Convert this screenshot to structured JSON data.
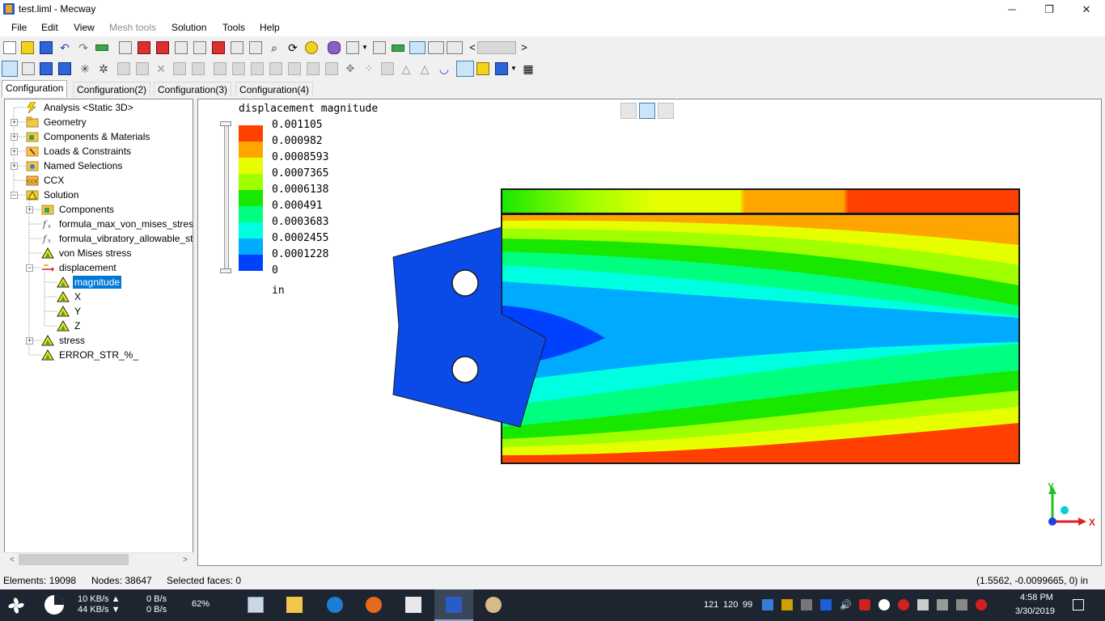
{
  "window": {
    "title": "test.liml - Mecway",
    "minimize": "─",
    "restore": "❐",
    "close": "✕"
  },
  "menu": [
    {
      "label": "File",
      "enabled": true
    },
    {
      "label": "Edit",
      "enabled": true
    },
    {
      "label": "View",
      "enabled": true
    },
    {
      "label": "Mesh tools",
      "enabled": false
    },
    {
      "label": "Solution",
      "enabled": true
    },
    {
      "label": "Tools",
      "enabled": true
    },
    {
      "label": "Help",
      "enabled": true
    }
  ],
  "toolbar": {
    "scroll_left": "<",
    "scroll_right": ">"
  },
  "tabs": [
    "Configuration",
    "Configuration(2)",
    "Configuration(3)",
    "Configuration(4)"
  ],
  "tree": [
    {
      "label": "Analysis <Static 3D>",
      "icon": "lightning-icon"
    },
    {
      "label": "Geometry",
      "icon": "folder-icon"
    },
    {
      "label": "Components & Materials",
      "icon": "components-icon"
    },
    {
      "label": "Loads & Constraints",
      "icon": "loads-icon"
    },
    {
      "label": "Named Selections",
      "icon": "named-selections-icon"
    },
    {
      "label": "CCX",
      "icon": "ccx-icon"
    },
    {
      "label": "Solution",
      "icon": "solution-icon"
    },
    {
      "label": "Components",
      "icon": "components-icon"
    },
    {
      "label": "formula_max_von_mises_stress_",
      "icon": "formula-icon"
    },
    {
      "label": "formula_vibratory_allowable_stre",
      "icon": "formula-icon"
    },
    {
      "label": "von Mises stress",
      "icon": "contour-icon"
    },
    {
      "label": "displacement",
      "icon": "displacement-icon"
    },
    {
      "label": "magnitude",
      "icon": "contour-icon"
    },
    {
      "label": "X",
      "icon": "contour-icon"
    },
    {
      "label": "Y",
      "icon": "contour-icon"
    },
    {
      "label": "Z",
      "icon": "contour-icon"
    },
    {
      "label": "stress",
      "icon": "contour-icon"
    },
    {
      "label": "ERROR_STR_%_",
      "icon": "contour-icon"
    }
  ],
  "tree_scroll": {
    "left": "<",
    "right": ">"
  },
  "legend": {
    "title": "displacement magnitude",
    "values": [
      "0.001105",
      "0.000982",
      "0.0008593",
      "0.0007365",
      "0.0006138",
      "0.000491",
      "0.0003683",
      "0.0002455",
      "0.0001228",
      "0"
    ],
    "colors": [
      "#ff4000",
      "#ffa500",
      "#e6ff00",
      "#a0ff00",
      "#18e800",
      "#00ff80",
      "#00ffe0",
      "#00aaff",
      "#0040ff"
    ],
    "unit": "in"
  },
  "triad": {
    "y": "Y",
    "x": "X"
  },
  "status": {
    "elements": "Elements: 19098",
    "nodes": "Nodes: 38647",
    "selected": "Selected faces: 0",
    "coords": "(1.5562, -0.0099665, 0) in"
  },
  "taskbar": {
    "net_up": "10 KB/s ▲",
    "net_down": "44 KB/s ▼",
    "disk_read": "0 B/s",
    "disk_write": "0 B/s",
    "cpu": "62%",
    "tray_nums": [
      "121",
      "120",
      "99"
    ],
    "time": "4:58 PM",
    "date": "3/30/2019"
  }
}
